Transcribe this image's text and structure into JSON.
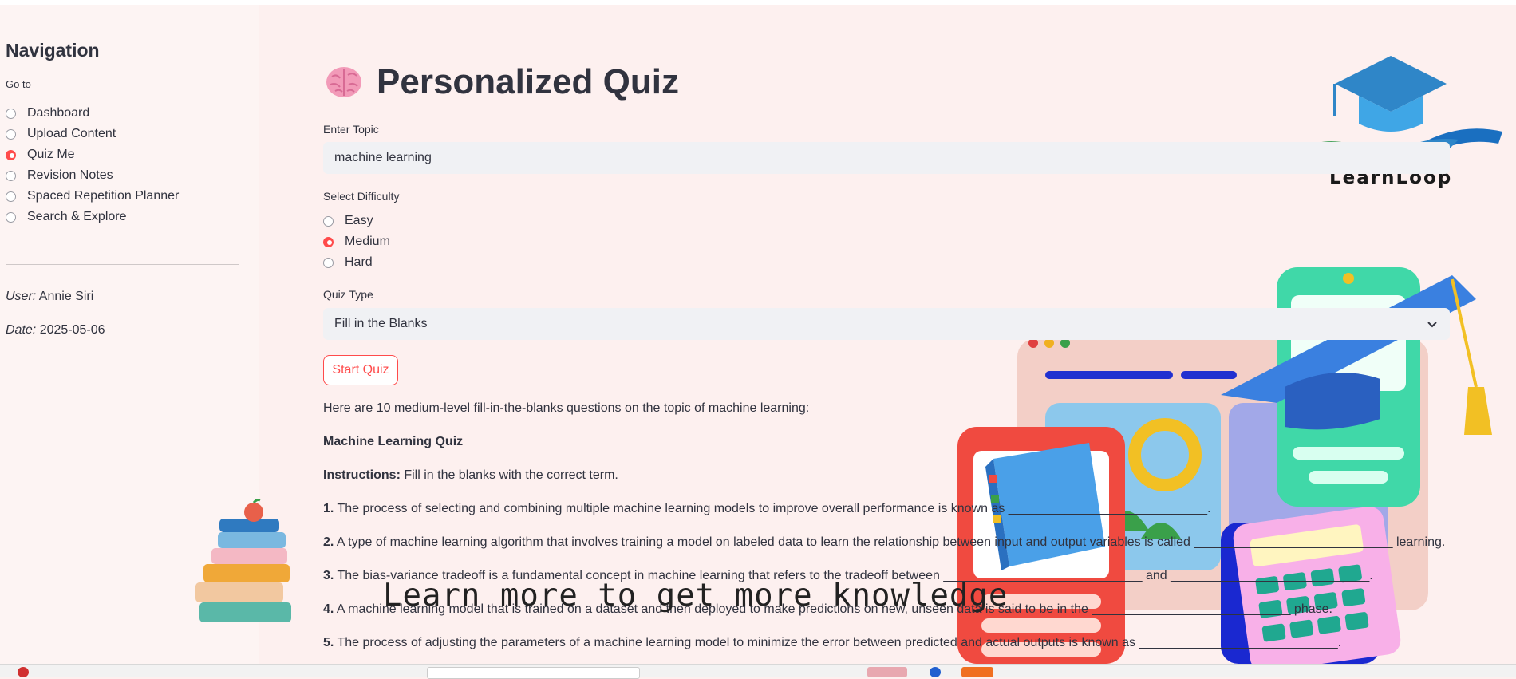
{
  "sidebar": {
    "title": "Navigation",
    "goto_label": "Go to",
    "items": [
      {
        "label": "Dashboard",
        "selected": false
      },
      {
        "label": "Upload Content",
        "selected": false
      },
      {
        "label": "Quiz Me",
        "selected": true
      },
      {
        "label": "Revision Notes",
        "selected": false
      },
      {
        "label": "Spaced Repetition Planner",
        "selected": false
      },
      {
        "label": "Search & Explore",
        "selected": false
      }
    ],
    "user_label": "User:",
    "user_value": "Annie Siri",
    "date_label": "Date:",
    "date_value": "2025-05-06"
  },
  "main": {
    "title": "Personalized Quiz",
    "title_icon": "brain-icon",
    "topic_label": "Enter Topic",
    "topic_value": "machine learning",
    "difficulty_label": "Select Difficulty",
    "difficulty_options": [
      {
        "label": "Easy",
        "selected": false
      },
      {
        "label": "Medium",
        "selected": true
      },
      {
        "label": "Hard",
        "selected": false
      }
    ],
    "quiz_type_label": "Quiz Type",
    "quiz_type_value": "Fill in the Blanks",
    "start_button": "Start Quiz",
    "intro": "Here are 10 medium-level fill-in-the-blanks questions on the topic of machine learning:",
    "quiz_heading": "Machine Learning Quiz",
    "instructions_label": "Instructions:",
    "instructions_text": " Fill in the blanks with the correct term.",
    "questions": [
      {
        "num": "1.",
        "text": " The process of selecting and combining multiple machine learning models to improve overall performance is known as ____________________________."
      },
      {
        "num": "2.",
        "text": " A type of machine learning algorithm that involves training a model on labeled data to learn the relationship between input and output variables is called ____________________________ learning."
      },
      {
        "num": "3.",
        "text": " The bias-variance tradeoff is a fundamental concept in machine learning that refers to the tradeoff between ____________________________ and ____________________________."
      },
      {
        "num": "4.",
        "text": " A machine learning model that is trained on a dataset and then deployed to make predictions on new, unseen data is said to be in the ____________________________ phase."
      },
      {
        "num": "5.",
        "text": " The process of adjusting the parameters of a machine learning model to minimize the error between predicted and actual outputs is known as ____________________________."
      }
    ]
  },
  "branding": {
    "logo_text": "LearnLoop",
    "motto": "Learn more to get more knowledge"
  },
  "colors": {
    "accent": "#ff4b4b",
    "background": "#fdf0ef",
    "input_bg": "#f0f1f4",
    "text": "#31333f"
  }
}
